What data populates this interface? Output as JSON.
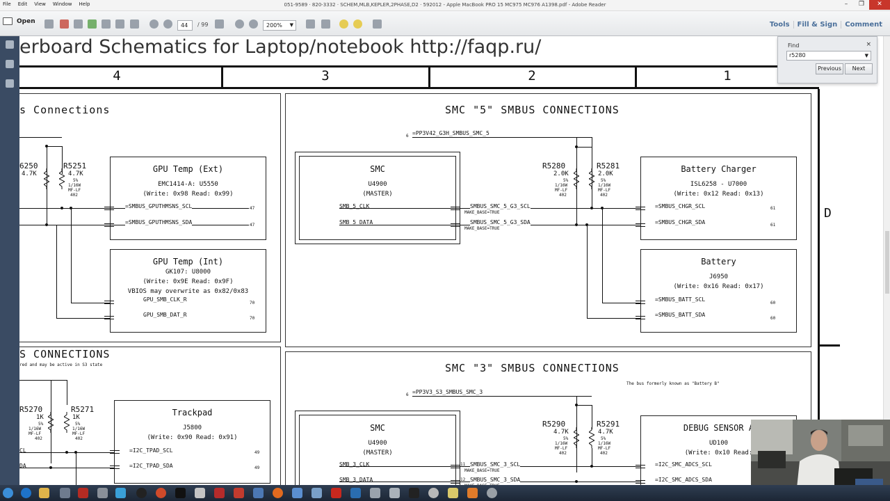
{
  "window": {
    "title": "051-9589 · 820-3332 · SCHEM,MLB,KEPLER,2PHASE,D2 · 592012 - Apple MacBook PRO 15 MC975 MC976 A1398.pdf - Adobe Reader",
    "menu": [
      "File",
      "Edit",
      "View",
      "Window",
      "Help"
    ]
  },
  "toolbar": {
    "open_label": "Open",
    "page_current": "44",
    "page_total": "/ 99",
    "zoom": "200%",
    "right_tabs": [
      "Tools",
      "Fill & Sign",
      "Comment"
    ]
  },
  "find": {
    "label": "Find",
    "close": "×",
    "query": "r5280",
    "previous": "Previous",
    "next": "Next"
  },
  "document": {
    "header": "erboard Schematics for Laptop/notebook http://faqp.ru/",
    "zones": [
      "4",
      "3",
      "2",
      "1"
    ],
    "zone_letter": "D",
    "left_top": {
      "title": "s Connections",
      "res_left": {
        "ref": "6250",
        "val": "4.7K"
      },
      "res_right": {
        "ref": "R5251",
        "val": "4.7K",
        "tol": "5%",
        "pwr": "1/16W",
        "type": "MF-LF",
        "pkg": "402"
      },
      "gpu_ext": {
        "title": "GPU Temp (Ext)",
        "part": "EMC1414-A: U5550",
        "addr": "(Write: 0x98 Read: 0x99)",
        "scl": "=SMBUS_GPUTHMSNS_SCL",
        "sda": "=SMBUS_GPUTHMSNS_SDA",
        "pin": "47"
      },
      "gpu_int": {
        "title": "GPU Temp (Int)",
        "part": "GK107: U8000",
        "addr": "(Write: 0x9E Read: 0x9F)",
        "note": "VBIOS may overwrite as 0x82/0x83",
        "clk": "GPU_SMB_CLK_R",
        "dat": "GPU_SMB_DAT_R",
        "pin": "70"
      }
    },
    "smc5": {
      "title": "SMC \"5\" SMBUS CONNECTIONS",
      "rail": "=PP3V42_G3H_SMBUS_SMC_5",
      "smc": {
        "title": "SMC",
        "part": "U4900",
        "role": "(MASTER)",
        "clk": "SMB_5_CLK",
        "data": "SMB_5_DATA"
      },
      "net_scl": "SMBUS_SMC_5_G3_SCL",
      "net_sda": "SMBUS_SMC_5_G3_SDA",
      "make_base": "MAKE_BASE=TRUE",
      "r5280": {
        "ref": "R5280",
        "val": "2.0K",
        "tol": "5%",
        "pwr": "1/16W",
        "type": "MF-LF",
        "pkg": "402"
      },
      "r5281": {
        "ref": "R5281",
        "val": "2.0K",
        "tol": "5%",
        "pwr": "1/16W",
        "type": "MF-LF",
        "pkg": "402"
      },
      "charger": {
        "title": "Battery Charger",
        "part": "ISL6258 - U7000",
        "addr": "(Write: 0x12 Read: 0x13)",
        "scl": "=SMBUS_CHGR_SCL",
        "sda": "=SMBUS_CHGR_SDA",
        "pin": "61"
      },
      "battery": {
        "title": "Battery",
        "part": "J6950",
        "addr": "(Write: 0x16 Read: 0x17)",
        "scl": "=SMBUS_BATT_SCL",
        "sda": "=SMBUS_BATT_SDA",
        "pin": "60"
      }
    },
    "left_bottom": {
      "title": "S CONNECTIONS",
      "note": "red and may be active in S3 state",
      "r5270": {
        "ref": "R5270",
        "val": "1K",
        "tol": "5%",
        "pwr": "1/16W",
        "type": "MF-LF",
        "pkg": "402"
      },
      "r5271": {
        "ref": "R5271",
        "val": "1K",
        "tol": "5%",
        "pwr": "1/16W",
        "type": "MF-LF",
        "pkg": "402"
      },
      "trackpad": {
        "title": "Trackpad",
        "part": "J5800",
        "addr": "(Write: 0x90 Read: 0x91)",
        "scl": "=I2C_TPAD_SCL",
        "sda": "=I2C_TPAD_SDA",
        "pin": "49"
      },
      "left_scl": "CL",
      "left_sda": "DA"
    },
    "smc3": {
      "title": "SMC \"3\" SMBUS CONNECTIONS",
      "note": "The bus formerly known as \"Battery B\"",
      "rail": "=PP3V3_S3_SMBUS_SMC_3",
      "smc": {
        "title": "SMC",
        "part": "U4900",
        "role": "(MASTER)",
        "clk": "SMB_3_CLK",
        "data": "SMB_3_DATA"
      },
      "net_scl": "SMBUS_SMC_3_SCL",
      "net_sda": "SMBUS_SMC_3_SDA",
      "make_base": "MAKE_BASE=TRUE",
      "r5290": {
        "ref": "R5290",
        "val": "4.7K",
        "tol": "5%",
        "pwr": "1/16W",
        "type": "MF-LF",
        "pkg": "402"
      },
      "r5291": {
        "ref": "R5291",
        "val": "4.7K",
        "tol": "5%",
        "pwr": "1/16W",
        "type": "MF-LF",
        "pkg": "402"
      },
      "debug": {
        "title": "DEBUG SENSOR A",
        "part": "UD100",
        "addr": "(Write: 0x10 Read:",
        "scl": "=I2C_SMC_ADCS_SCL",
        "sda": "=I2C_SMC_ADCS_SDA"
      }
    },
    "pin_labels": {
      "r1": "1",
      "r2": "2",
      "rail_pin": "6",
      "scl_pin": "11",
      "sda_pin": "12"
    }
  },
  "colors": {
    "nav": "#3a4b63",
    "accent": "#4a6f9a",
    "taskbar": "#1c2635"
  }
}
